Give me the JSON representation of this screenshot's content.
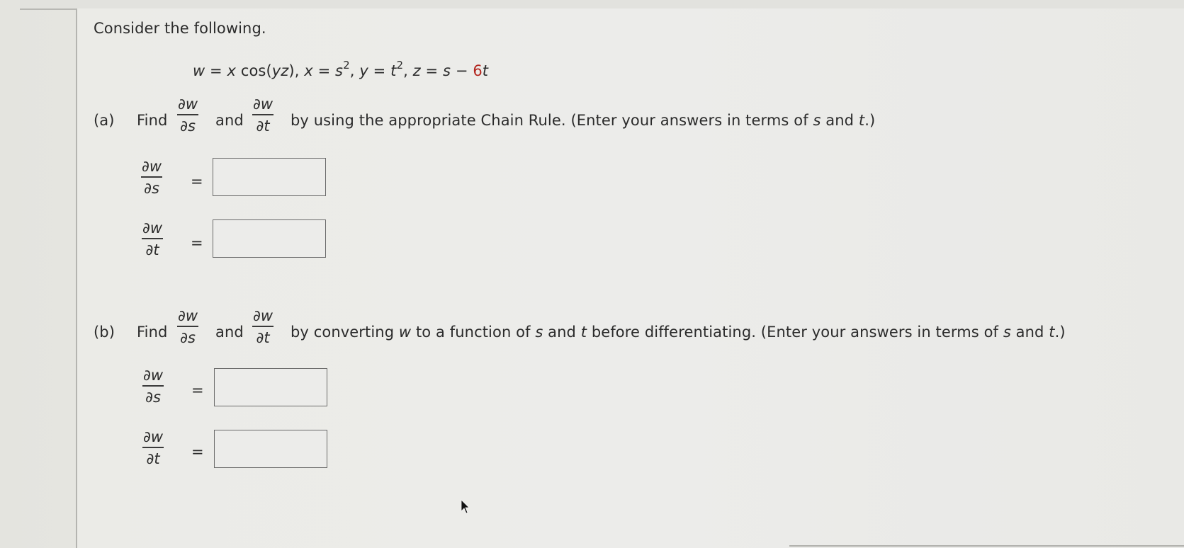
{
  "intro": "Consider the following.",
  "equation": {
    "w_def": "w = x cos(yz),",
    "x_def_lhs": "x = s",
    "x_exp": "2",
    "y_def_lhs": "y = t",
    "y_exp": "2",
    "z_def": "z = s − ",
    "z_coef": "6",
    "z_var": "t"
  },
  "part_a": {
    "label": "(a)",
    "find": "Find",
    "and": "and",
    "instruction": "by using the appropriate Chain Rule. (Enter your answers in terms of ",
    "var_s": "s",
    "and2": " and ",
    "var_t": "t",
    "tail": ".)",
    "answers": [
      {
        "numerator": "∂w",
        "denominator": "∂s",
        "equals": "=",
        "value": "",
        "placeholder": ""
      },
      {
        "numerator": "∂w",
        "denominator": "∂t",
        "equals": "=",
        "value": "",
        "placeholder": ""
      }
    ]
  },
  "part_b": {
    "label": "(b)",
    "find": "Find",
    "and": "and",
    "instruction_1": "by converting ",
    "var_w": "w",
    "instruction_2": " to a function of ",
    "var_s": "s",
    "and2": " and ",
    "var_t": "t",
    "instruction_3": " before differentiating. (Enter your answers in terms of ",
    "var_s2": "s",
    "and3": " and ",
    "var_t2": "t",
    "tail": ".)",
    "answers": [
      {
        "numerator": "∂w",
        "denominator": "∂s",
        "equals": "=",
        "value": "",
        "placeholder": ""
      },
      {
        "numerator": "∂w",
        "denominator": "∂t",
        "equals": "=",
        "value": "",
        "placeholder": ""
      }
    ]
  },
  "fractions": {
    "dw": "∂w",
    "ds": "∂s",
    "dt": "∂t"
  },
  "colors": {
    "accent_red": "#b3261e",
    "text": "#2b2b2b",
    "background": "#ebebe7"
  },
  "icons": {
    "pointer": "mouse-pointer-icon"
  }
}
